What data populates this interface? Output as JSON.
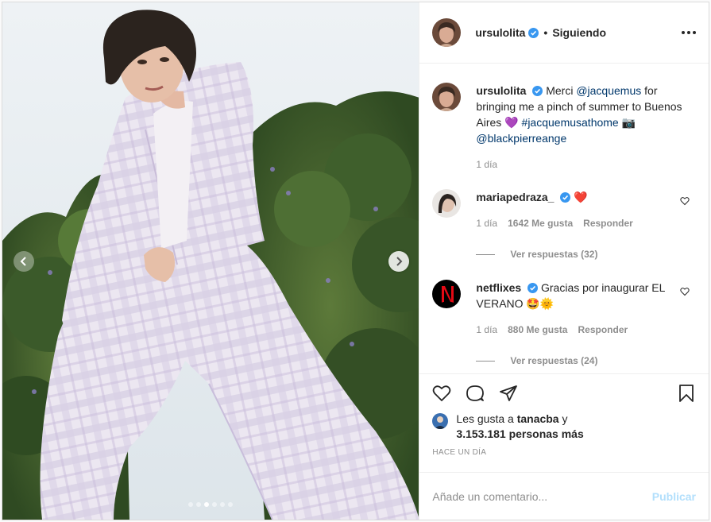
{
  "header": {
    "username": "ursulolita",
    "separator": "•",
    "follow_status": "Siguiendo"
  },
  "caption": {
    "username": "ursulolita",
    "text_before": "Merci",
    "mention_1": "@jacquemus",
    "text_middle": "for bringing me a pinch of summer to Buenos Aires",
    "emoji_heart": "💜",
    "hashtag": "#jacquemusathome",
    "emoji_camera": "📷",
    "mention_2": "@blackpierreange",
    "time": "1 día"
  },
  "comments": [
    {
      "username": "mariapedraza_",
      "text": "❤️",
      "time": "1 día",
      "likes": "1642 Me gusta",
      "reply_label": "Responder",
      "view_replies": "Ver respuestas (32)"
    },
    {
      "username": "netflixes",
      "text": "Gracias por inaugurar EL VERANO 🤩🌞",
      "time": "1 día",
      "likes": "880 Me gusta",
      "reply_label": "Responder",
      "view_replies": "Ver respuestas (24)"
    }
  ],
  "likes_summary": {
    "prefix": "Les gusta a",
    "user": "tanacba",
    "connector": "y",
    "others": "3.153.181 personas más"
  },
  "time_ago": "HACE UN DÍA",
  "add_comment": {
    "placeholder": "Añade un comentario...",
    "publish_label": "Publicar"
  },
  "carousel": {
    "total": 6,
    "active_index": 2
  },
  "colors": {
    "verified": "#3897f0",
    "mention": "#00376b",
    "publish_disabled": "#b2dffc",
    "muted": "#8e8e8e"
  }
}
